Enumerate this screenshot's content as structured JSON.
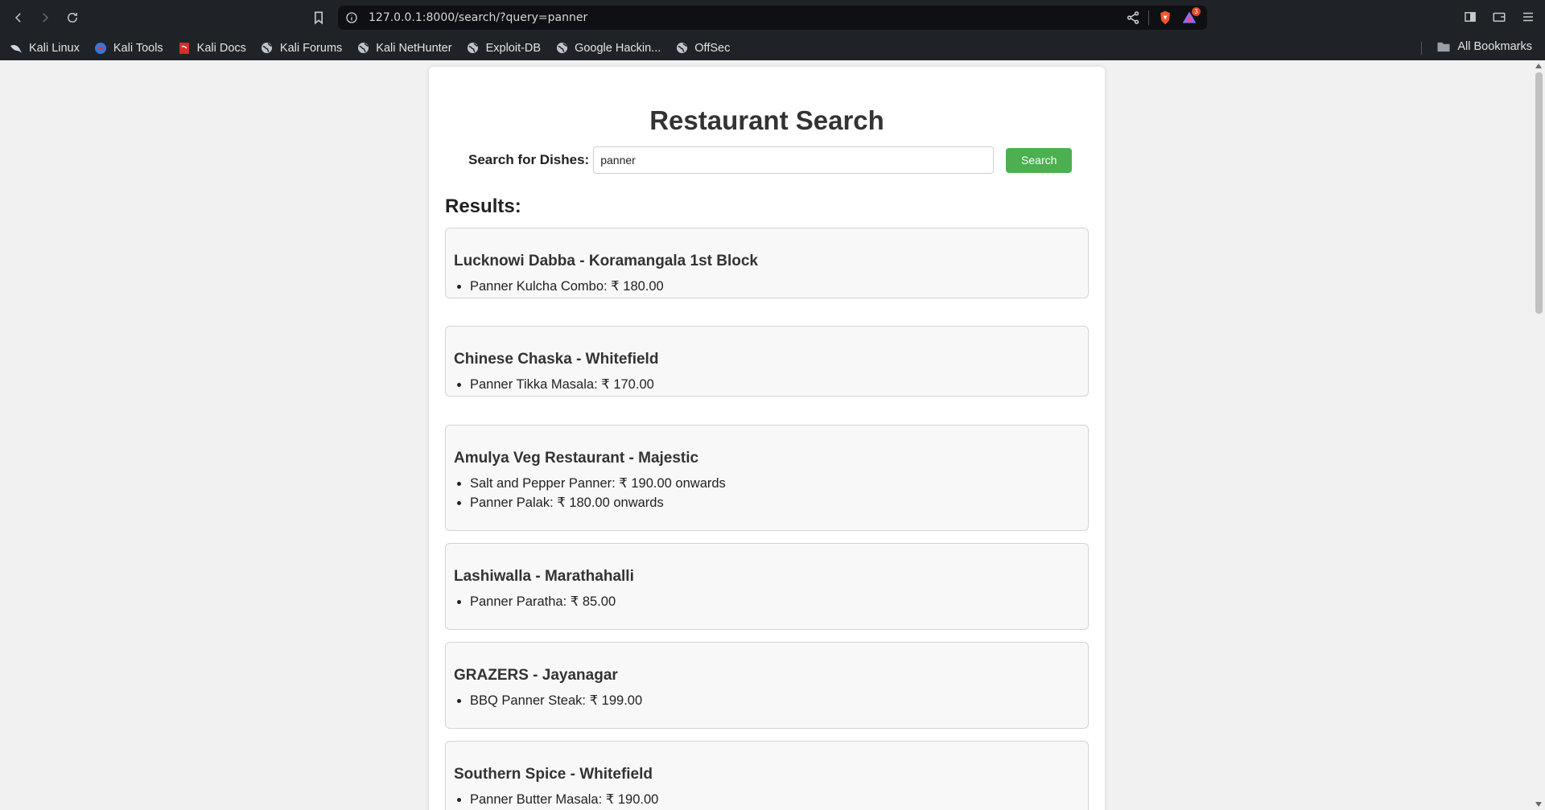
{
  "browser": {
    "url": "127.0.0.1:8000/search/?query=panner",
    "rewards_badge": "3",
    "bookmarks": [
      {
        "label": "Kali Linux",
        "icon": "kali-dragon-icon"
      },
      {
        "label": "Kali Tools",
        "icon": "kali-tools-icon"
      },
      {
        "label": "Kali Docs",
        "icon": "kali-docs-icon"
      },
      {
        "label": "Kali Forums",
        "icon": "globe-icon"
      },
      {
        "label": "Kali NetHunter",
        "icon": "globe-icon"
      },
      {
        "label": "Exploit-DB",
        "icon": "globe-icon"
      },
      {
        "label": "Google Hackin...",
        "icon": "globe-icon"
      },
      {
        "label": "OffSec",
        "icon": "globe-icon"
      }
    ],
    "all_bookmarks": "All Bookmarks"
  },
  "page": {
    "title": "Restaurant Search",
    "search_label": "Search for Dishes:",
    "search_value": "panner",
    "search_button": "Search",
    "results_heading": "Results:",
    "results": [
      {
        "name": "Lucknowi Dabba - Koramangala 1st Block",
        "items": [
          "Panner Kulcha Combo: ₹ 180.00"
        ]
      },
      {
        "name": "Chinese Chaska - Whitefield",
        "items": [
          "Panner Tikka Masala: ₹ 170.00"
        ]
      },
      {
        "name": "Amulya Veg Restaurant - Majestic",
        "items": [
          "Salt and Pepper Panner: ₹ 190.00 onwards",
          "Panner Palak: ₹ 180.00 onwards"
        ]
      },
      {
        "name": "Lashiwalla - Marathahalli",
        "items": [
          "Panner Paratha: ₹ 85.00"
        ]
      },
      {
        "name": "GRAZERS - Jayanagar",
        "items": [
          "BBQ Panner Steak: ₹ 199.00"
        ]
      },
      {
        "name": "Southern Spice - Whitefield",
        "items": [
          "Panner Butter Masala: ₹ 190.00"
        ]
      }
    ]
  },
  "colors": {
    "chrome_bg": "#1f2227",
    "urlbar_bg": "#0e1013",
    "search_button": "#4caf50",
    "page_bg": "#f1f1f1"
  }
}
